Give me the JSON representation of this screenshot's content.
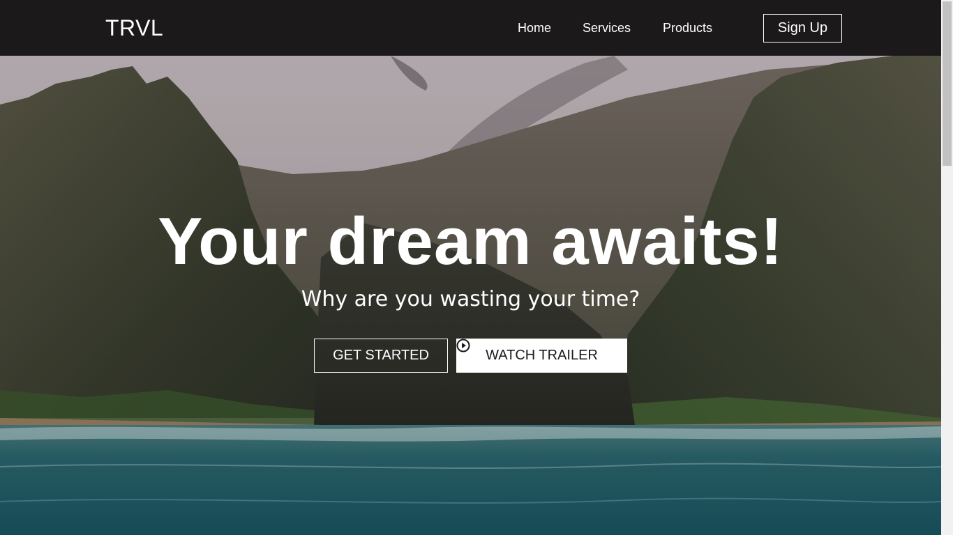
{
  "navbar": {
    "logo": "TRVL",
    "links": [
      "Home",
      "Services",
      "Products"
    ],
    "signup_label": "Sign Up"
  },
  "hero": {
    "headline": "Your dream awaits!",
    "subheadline": "Why are you wasting your time?",
    "primary_button": "GET STARTED",
    "secondary_button": "WATCH TRAILER",
    "secondary_button_icon": "play-circle-icon",
    "background_image": "coastal-cliffs-ocean-photo"
  },
  "colors": {
    "navbar_bg": "#1b1919",
    "text": "#ffffff",
    "button_light_bg": "#ffffff",
    "button_light_text": "#1b1919",
    "ocean": "#1d5d66"
  }
}
